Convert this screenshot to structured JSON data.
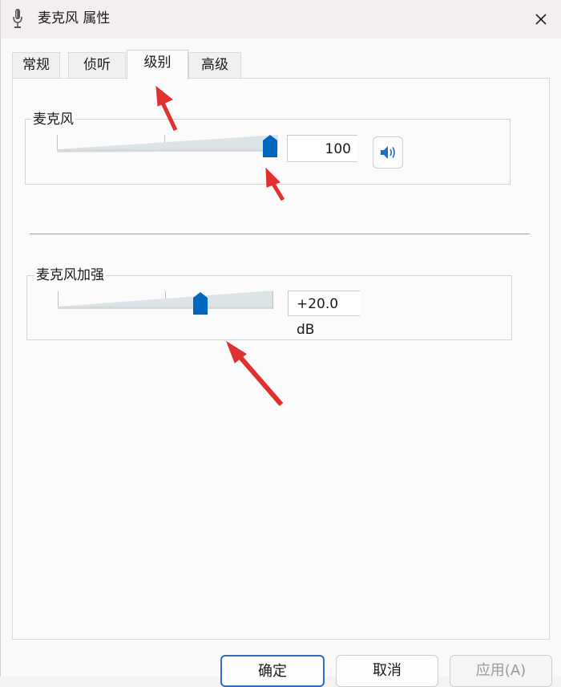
{
  "window": {
    "title": "麦克风 属性"
  },
  "tabs": [
    {
      "label": "常规",
      "active": false
    },
    {
      "label": "侦听",
      "active": false
    },
    {
      "label": "级别",
      "active": true
    },
    {
      "label": "高级",
      "active": false
    }
  ],
  "levels": {
    "microphone": {
      "label": "麦克风",
      "value": "100",
      "slider_percent": 100
    },
    "boost": {
      "label": "麦克风加强",
      "value": "+20.0 dB",
      "slider_percent": 67
    }
  },
  "buttons": {
    "ok": "确定",
    "cancel": "取消",
    "apply": "应用(A)"
  },
  "colors": {
    "accent": "#0067c0",
    "annotation": "#e03030"
  },
  "icons": {
    "title": "microphone-icon",
    "close": "close-icon",
    "mute": "speaker-icon"
  }
}
